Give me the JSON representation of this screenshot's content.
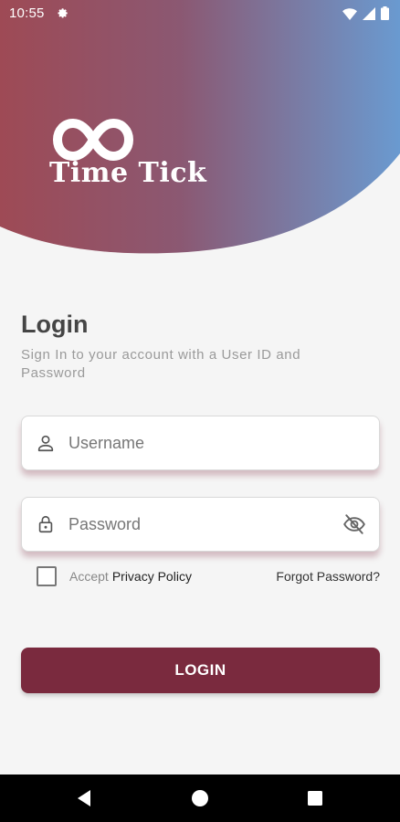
{
  "status_bar": {
    "time": "10:55",
    "icons": [
      "gear-icon",
      "wifi-icon",
      "signal-icon",
      "battery-icon"
    ]
  },
  "app": {
    "name": "Time Tick",
    "logo_icon": "infinity-icon"
  },
  "login": {
    "title": "Login",
    "subtitle": "Sign In to your account with a User ID and Password",
    "username_placeholder": "Username",
    "password_placeholder": "Password",
    "accept_text": "Accept",
    "privacy_link": "Privacy Policy",
    "forgot_password": "Forgot Password?",
    "login_button": "LOGIN"
  },
  "nav_bar": {
    "icons": [
      "back-icon",
      "home-icon",
      "recents-icon"
    ]
  },
  "colors": {
    "gradient_start": "#9e4a55",
    "gradient_end": "#6a9ad0",
    "accent": "#7a2a3e",
    "background": "#f5f5f5"
  }
}
